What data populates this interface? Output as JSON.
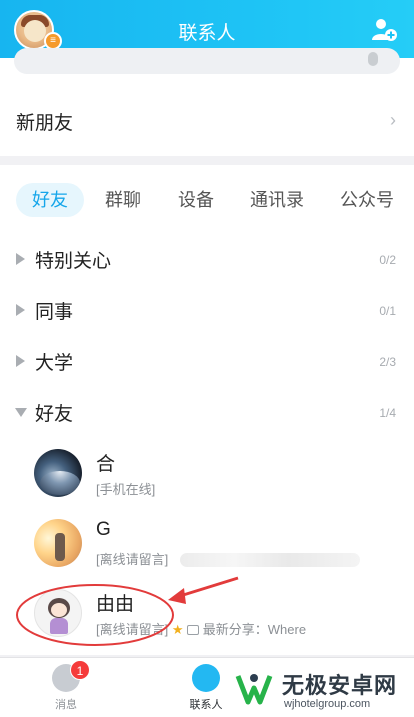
{
  "header": {
    "title": "联系人"
  },
  "new_friends": {
    "label": "新朋友"
  },
  "tabs": [
    {
      "label": "好友",
      "active": true
    },
    {
      "label": "群聊"
    },
    {
      "label": "设备"
    },
    {
      "label": "通讯录"
    },
    {
      "label": "公众号"
    }
  ],
  "groups": [
    {
      "name": "特别关心",
      "count": "0/2",
      "expanded": false
    },
    {
      "name": "同事",
      "count": "0/1",
      "expanded": false
    },
    {
      "name": "大学",
      "count": "2/3",
      "expanded": false
    },
    {
      "name": "好友",
      "count": "1/4",
      "expanded": true
    }
  ],
  "contacts": [
    {
      "name": "合",
      "status": "[手机在线]"
    },
    {
      "name": "G",
      "status": "[离线请留言]"
    },
    {
      "name": "由由",
      "status": "[离线请留言]",
      "share": "最新分享：Where"
    }
  ],
  "bottom_nav": [
    {
      "label": "消息",
      "badge": "1"
    },
    {
      "label": "联系人",
      "active": true
    }
  ],
  "colors": {
    "header": "#1ec3f5",
    "accent": "#15a6ea",
    "badge": "#f53b3b",
    "annotation": "#e23b3b"
  },
  "watermark": {
    "brand": "无极安卓网",
    "site": "wjhotelgroup.com"
  }
}
